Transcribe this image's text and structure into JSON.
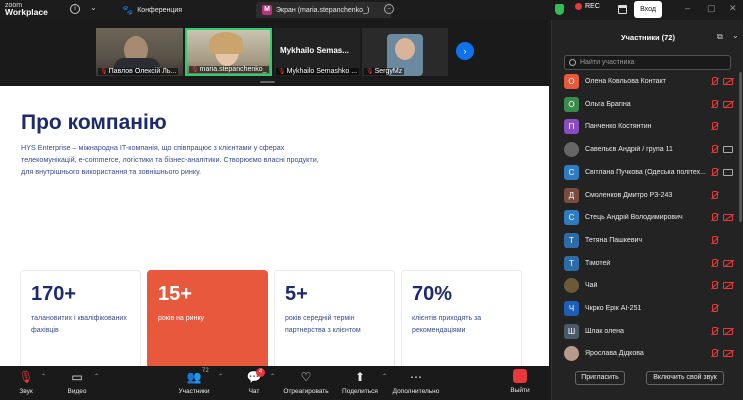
{
  "app": {
    "logo_line1": "zoom",
    "logo_line2": "Workplace",
    "tabs": [
      {
        "label": "Конференция"
      },
      {
        "label": "Экран (maria.stepanchenko_)",
        "badge": "M"
      }
    ],
    "rec_label": "REC",
    "login_label": "Вход",
    "accent": "#0e72ed",
    "danger": "#e8383b"
  },
  "video_strip": {
    "tiles": [
      {
        "label": "Павлов Олексій Ль..."
      },
      {
        "label": "maria.stepanchenko_"
      },
      {
        "label": "Mykhailo Semashko ...",
        "title": "Mykhailo  Semas..."
      },
      {
        "label": "SergyMz"
      }
    ]
  },
  "slide": {
    "title": "Про компанію",
    "paragraph": "HYS Enterprise – міжнародна IT-компанія, що співпрацює з клієнтами у сферах телекомунікацій, e-commerce, логістики та бізнес-аналітики. Створюємо власні продукти, для внутрішнього використання та зовнішнього ринку.",
    "cards": [
      {
        "num": "170+",
        "desc": "талановитих і кваліфікованих фахівців",
        "highlight": false
      },
      {
        "num": "15+",
        "desc": "років на ринку",
        "highlight": true
      },
      {
        "num": "5+",
        "desc": "років середній термін партнерства з клієнтом",
        "highlight": false
      },
      {
        "num": "70%",
        "desc": "клієнтів приходять за рекомендаціями",
        "highlight": false
      }
    ]
  },
  "toolbar": {
    "audio": "Звук",
    "video": "Видео",
    "participants": "Участники",
    "participants_count": "72",
    "chat": "Чат",
    "chat_badge": "4",
    "react": "Отреагировать",
    "share": "Поделиться",
    "more": "Дополнительно",
    "leave": "Выйти"
  },
  "panel": {
    "title": "Участники (72)",
    "search_placeholder": "Найти участника",
    "invite_label": "Пригласить",
    "unmute_label": "Включить свой звук",
    "participants": [
      {
        "initial": "О",
        "color": "#e7583c",
        "name": "Олена Ковльова Контакт",
        "cam": "off"
      },
      {
        "initial": "О",
        "color": "#3a8a4c",
        "name": "Ольга Брагіна",
        "cam": "off"
      },
      {
        "initial": "П",
        "color": "#8a4cc2",
        "name": "Панченко Костянтин",
        "cam": "none"
      },
      {
        "initial": "",
        "color": "#666",
        "name": "Савельєв Андрій / група 11",
        "cam": "on",
        "photo": true
      },
      {
        "initial": "С",
        "color": "#2e7cc2",
        "name": "Світлана Пучкова (Одеська політех...",
        "cam": "on"
      },
      {
        "initial": "Д",
        "color": "#7a4c3c",
        "name": "Смоленков Дмитро РЗ-243",
        "cam": "none"
      },
      {
        "initial": "С",
        "color": "#2e7cc2",
        "name": "Стець Андрій Володимирович",
        "cam": "off"
      },
      {
        "initial": "Т",
        "color": "#2e6ca8",
        "name": "Тетяна Пашкевич",
        "cam": "none"
      },
      {
        "initial": "Т",
        "color": "#2e6ca8",
        "name": "Тімотей",
        "cam": "off"
      },
      {
        "initial": "",
        "color": "#6a5a3a",
        "name": "Чай",
        "cam": "off",
        "photo": true
      },
      {
        "initial": "Ч",
        "color": "#1d5fb8",
        "name": "Чкрко Ерік АІ-251",
        "cam": "none"
      },
      {
        "initial": "Ш",
        "color": "#4a5a6a",
        "name": "Шлак олена",
        "cam": "off"
      },
      {
        "initial": "",
        "color": "#b89a8a",
        "name": "Ярослава Дідкова",
        "cam": "off",
        "photo": true
      }
    ]
  }
}
